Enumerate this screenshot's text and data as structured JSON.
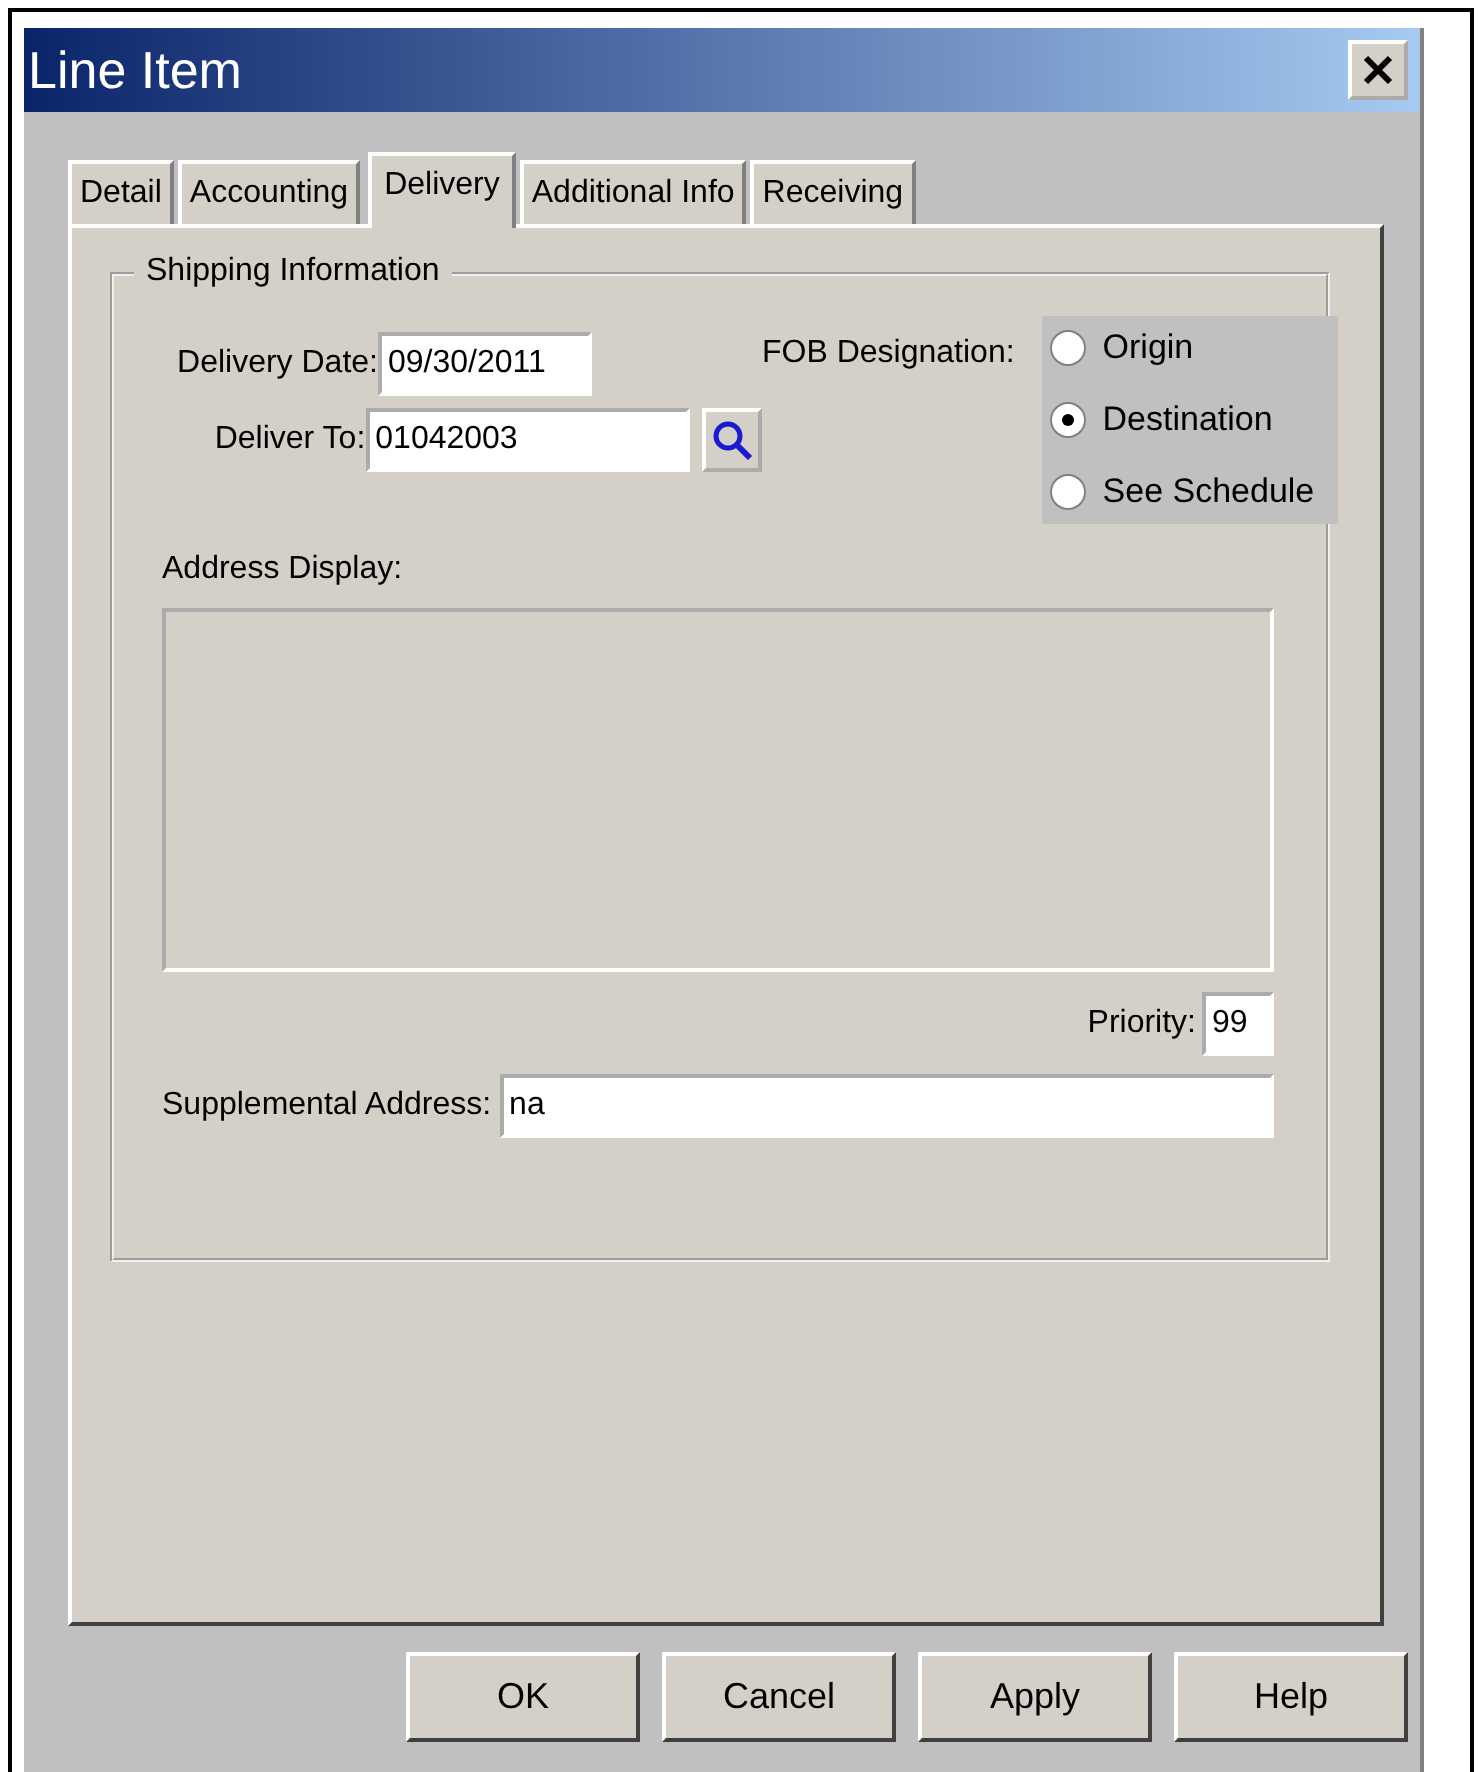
{
  "window": {
    "title": "Line Item"
  },
  "tabs": [
    {
      "label": "Detail",
      "selected": false
    },
    {
      "label": "Accounting",
      "selected": false
    },
    {
      "label": "Delivery",
      "selected": true
    },
    {
      "label": "Additional Info",
      "selected": false
    },
    {
      "label": "Receiving",
      "selected": false
    }
  ],
  "shipping": {
    "legend": "Shipping Information",
    "delivery_date": {
      "label": "Delivery Date:",
      "value": "09/30/2011"
    },
    "deliver_to": {
      "label": "Deliver To:",
      "value": "01042003"
    },
    "fob": {
      "label": "FOB Designation:",
      "options": [
        {
          "label": "Origin",
          "selected": false
        },
        {
          "label": "Destination",
          "selected": true
        },
        {
          "label": "See Schedule",
          "selected": false
        }
      ]
    },
    "address_display": {
      "label": "Address Display:"
    },
    "priority": {
      "label": "Priority:",
      "value": "99"
    },
    "supplemental_address": {
      "label": "Supplemental Address:",
      "value": "na"
    }
  },
  "buttons": [
    "OK",
    "Cancel",
    "Apply",
    "Help"
  ]
}
